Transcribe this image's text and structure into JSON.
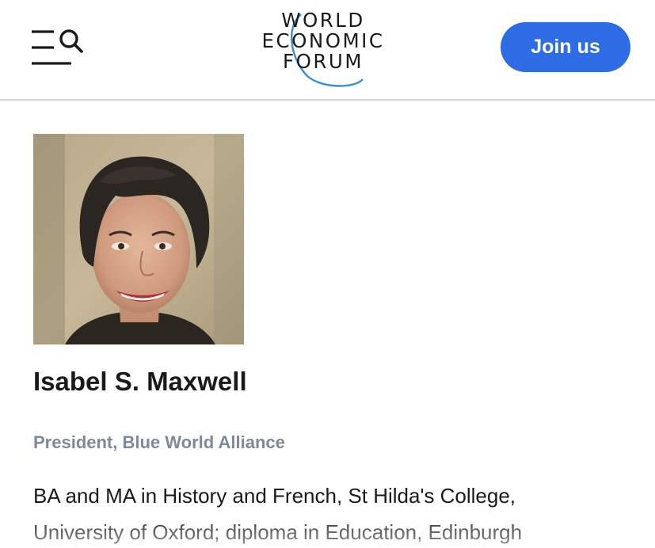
{
  "header": {
    "menu_icon": "menu-search-icon",
    "logo": {
      "line1": "WORLD",
      "line2": "ECONOMIC",
      "line3": "FORUM"
    },
    "join_label": "Join us"
  },
  "profile": {
    "photo_alt": "Isabel S. Maxwell",
    "name": "Isabel S. Maxwell",
    "role": "President, Blue World Alliance",
    "bio_lines": [
      "BA and MA in History and French, St Hilda's College,",
      "University of Oxford; diploma in Education, Edinburgh"
    ]
  },
  "colors": {
    "accent": "#2e6ce6",
    "logo_arc": "#3b8fd6",
    "role_text": "#7e8a99",
    "divider": "#d4d4d4"
  }
}
